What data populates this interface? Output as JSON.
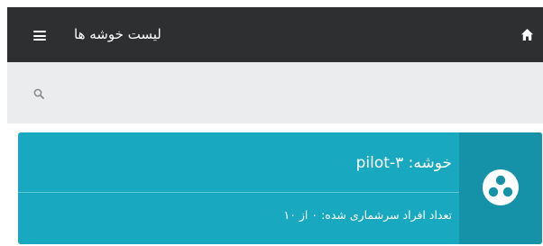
{
  "header": {
    "title": "لیست خوشه ها",
    "menu_icon": "hamburger-menu-icon",
    "home_icon": "home-icon"
  },
  "search": {
    "placeholder": "",
    "value": "",
    "icon": "search-icon"
  },
  "clusters": [
    {
      "title": "خوشه: pilot-۳",
      "subtitle": "تعداد افراد سرشماری شده: ۰ از ۱۰",
      "icon": "cluster-icon"
    }
  ],
  "colors": {
    "topbar": "#2e2f31",
    "searchbar": "#ebecee",
    "card": "#18a8bf",
    "card_icon_area": "#1692a8",
    "divider": "#5ec7d7"
  }
}
